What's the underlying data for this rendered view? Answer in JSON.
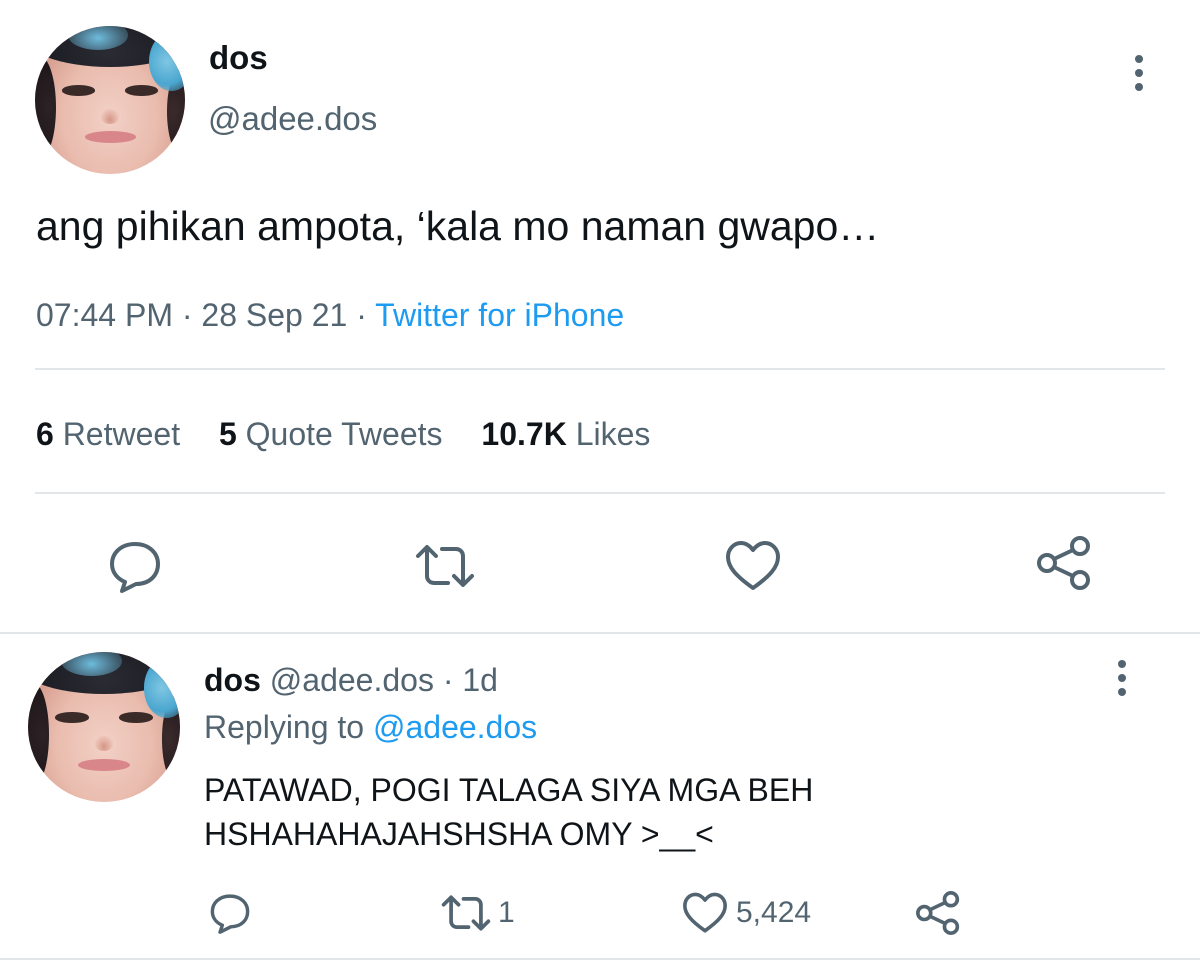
{
  "main_tweet": {
    "display_name": "dos",
    "handle": "@adee.dos",
    "text": "ang pihikan ampota, ‘kala mo naman gwapo…",
    "time": "07:44 PM",
    "date": "28 Sep 21",
    "source": "Twitter for iPhone",
    "sep": "·",
    "stats": {
      "retweets_count": "6",
      "retweets_label": "Retweet",
      "quotes_count": "5",
      "quotes_label": "Quote Tweets",
      "likes_count": "10.7K",
      "likes_label": "Likes"
    }
  },
  "reply_tweet": {
    "display_name": "dos",
    "handle": "@adee.dos",
    "sep": "·",
    "age": "1d",
    "replying_prefix": "Replying to",
    "replying_to": "@adee.dos",
    "text_line1": "PATAWAD, POGI TALAGA SIYA MGA BEH",
    "text_line2": "HSHAHAHAJAHSHSHA OMY >__<",
    "retweet_count": "1",
    "like_count": "5,424"
  },
  "icons": {
    "more": "more-vertical-icon",
    "reply": "reply-icon",
    "retweet": "retweet-icon",
    "like": "heart-icon",
    "share": "share-icon"
  },
  "colors": {
    "text_primary": "#0f1419",
    "text_secondary": "#536471",
    "link": "#1d9bf0",
    "divider": "#e3e6e8"
  }
}
